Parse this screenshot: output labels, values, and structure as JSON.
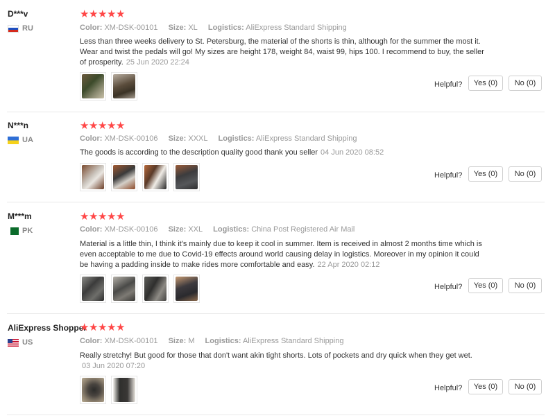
{
  "labels": {
    "color": "Color:",
    "size": "Size:",
    "logistics": "Logistics:",
    "helpful": "Helpful?"
  },
  "star_color": "#ff4747",
  "reviews": [
    {
      "user": "D***v",
      "country": "RU",
      "flag": "russia-flag",
      "rating": 5,
      "color": "XM-DSK-00101",
      "size": "XL",
      "logistics": "AliExpress Standard Shipping",
      "text": "Less than three weeks delivery to St. Petersburg, the material of the shorts is thin, although for the summer the most it. Wear and twist the pedals will go! My sizes are height 178, weight 84, waist 99, hips 100. I recommend to buy, the seller of prosperity.",
      "date": "25 Jun 2020 22:24",
      "yes": "Yes (0)",
      "no": "No (0)"
    },
    {
      "user": "N***n",
      "country": "UA",
      "flag": "ukraine-flag",
      "rating": 5,
      "color": "XM-DSK-00106",
      "size": "XXXL",
      "logistics": "AliExpress Standard Shipping",
      "text": "The goods is according to the description quality good thank you seller",
      "date": "04 Jun 2020 08:52",
      "yes": "Yes (0)",
      "no": "No (0)"
    },
    {
      "user": "M***m",
      "country": "PK",
      "flag": "pakistan-flag",
      "rating": 5,
      "color": "XM-DSK-00106",
      "size": "XXL",
      "logistics": "China Post Registered Air Mail",
      "text": "Material is a little thin, I think it's mainly due to keep it cool in summer. Item is received in almost 2 months time which is even acceptable to me due to Covid-19 effects around world causing delay in logistics. Moreover in my opinion it could be having a padding inside to make rides more comfortable and easy.",
      "date": "22 Apr 2020 02:12",
      "yes": "Yes (0)",
      "no": "No (0)"
    },
    {
      "user": "AliExpress Shopper",
      "country": "US",
      "flag": "usa-flag",
      "rating": 5,
      "color": "XM-DSK-00101",
      "size": "M",
      "logistics": "AliExpress Standard Shipping",
      "text": "Really stretchy! But good for those that don't want akin tight shorts. Lots of pockets and dry quick when they get wet.",
      "date": "03 Jun 2020 07:20",
      "yes": "Yes (0)",
      "no": "No (0)"
    }
  ]
}
